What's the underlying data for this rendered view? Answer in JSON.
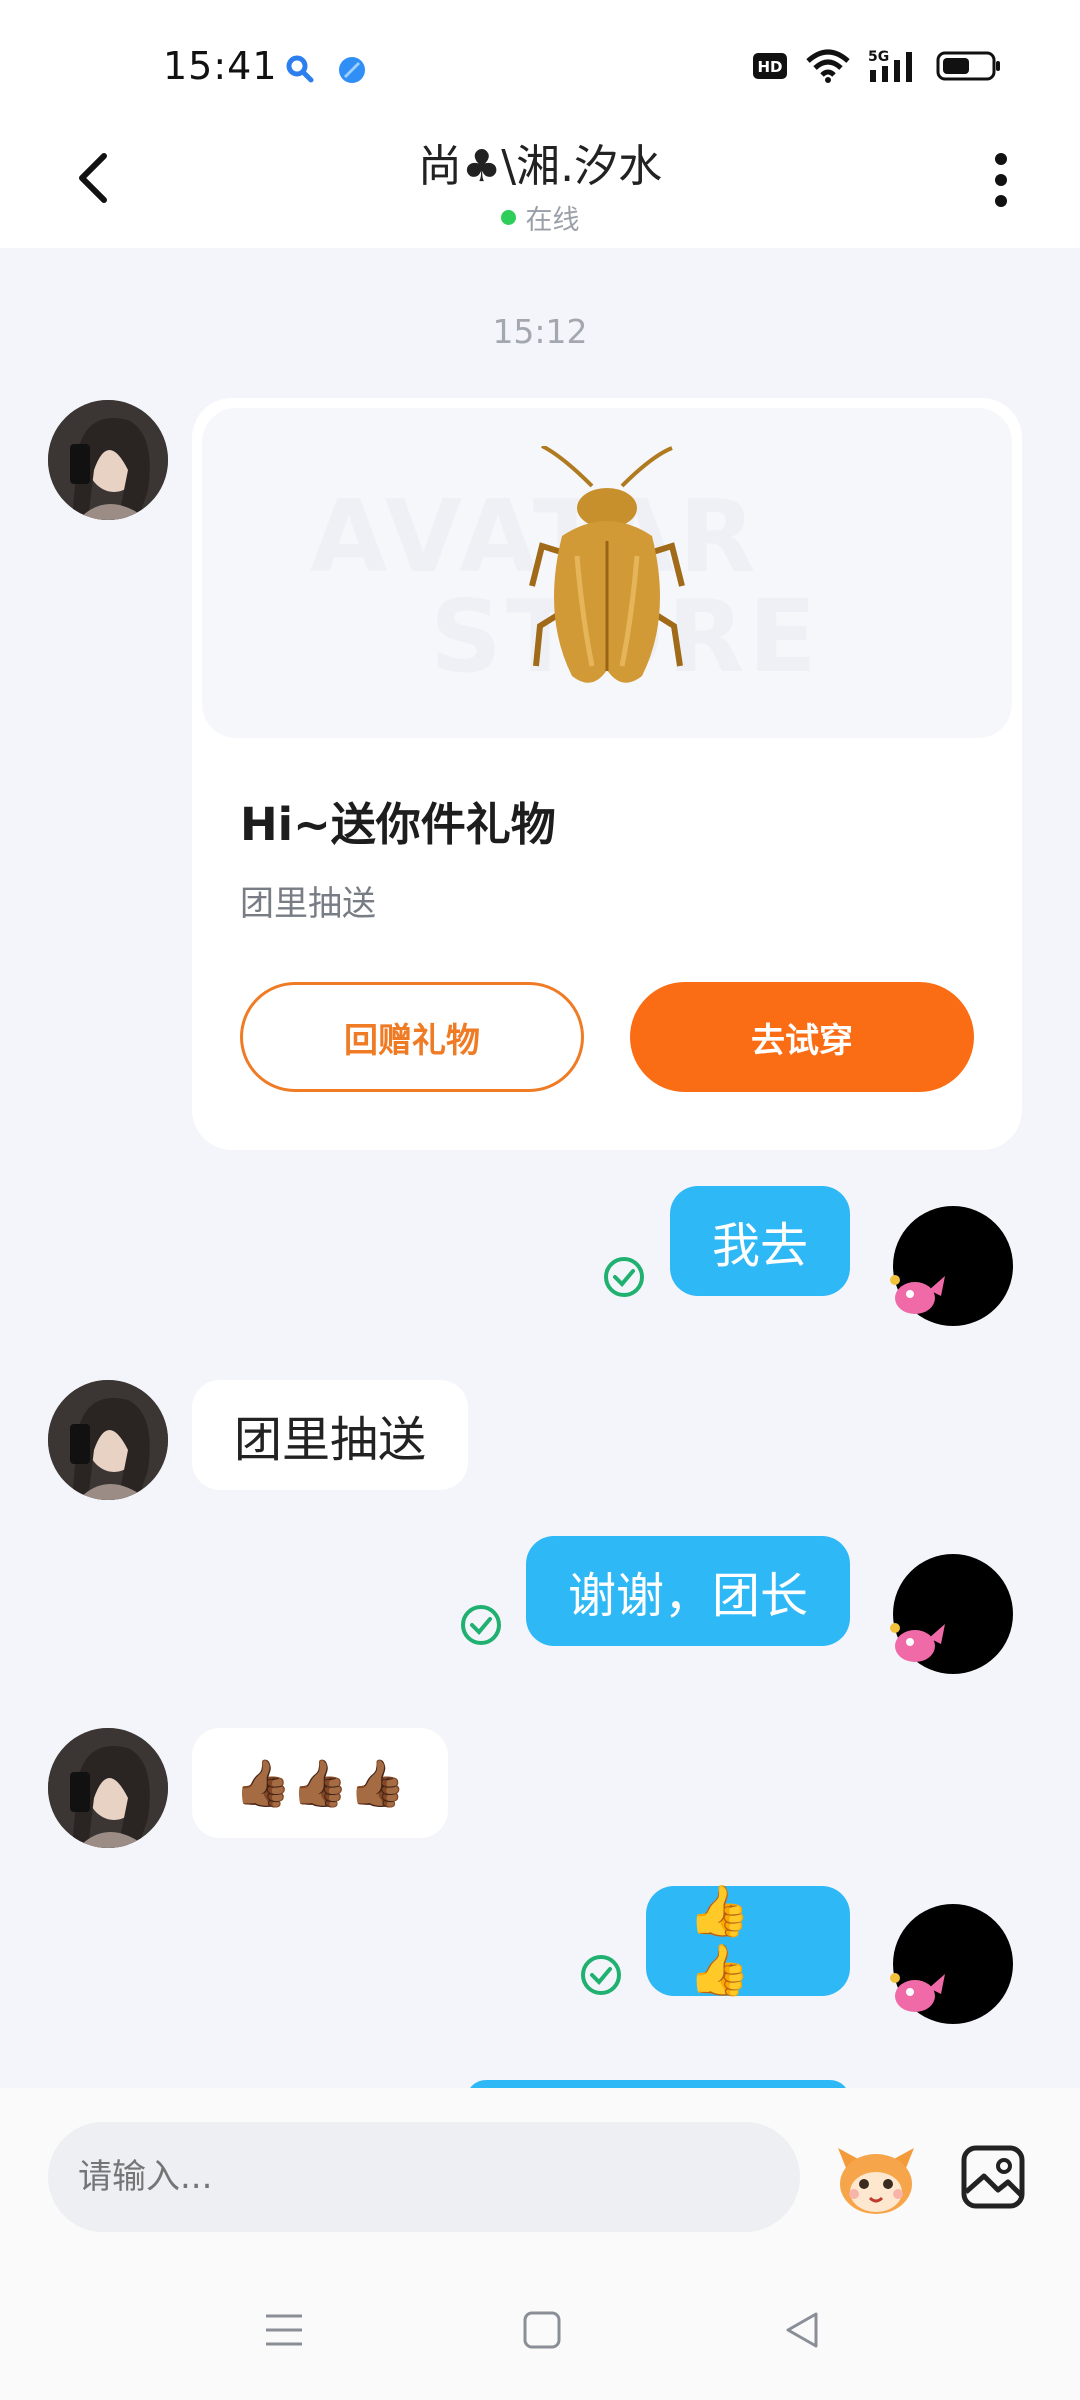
{
  "status_bar": {
    "time": "15:41",
    "icons": [
      "search-app-icon",
      "browser-app-icon",
      "hd-icon",
      "wifi-icon",
      "5g-signal-icon",
      "battery-icon"
    ],
    "hd_label": "HD",
    "network_label": "5G"
  },
  "header": {
    "title": "尚♣\\湘.汐水",
    "status": "在线",
    "status_color": "#2fce5a"
  },
  "chat": {
    "time_label": "15:12",
    "gift_card": {
      "title": "Hi~送你件礼物",
      "subtitle": "团里抽送",
      "watermark_1": "AVATAR",
      "watermark_2": "STORE",
      "button_return": "回赠礼物",
      "button_try": "去试穿",
      "accent_color": "#fb6d14"
    },
    "messages": [
      {
        "side": "right",
        "text": "我去"
      },
      {
        "side": "left",
        "text": "团里抽送"
      },
      {
        "side": "right",
        "text": "谢谢，团长"
      },
      {
        "side": "left",
        "text": "👍🏾👍🏾👍🏾"
      },
      {
        "side": "right",
        "text": "👍👍"
      }
    ],
    "bubble_color": "#2fb8f6"
  },
  "input_bar": {
    "placeholder": "请输入..."
  },
  "nav_bar": {
    "items": [
      "menu-icon",
      "home-icon",
      "back-triangle-icon"
    ]
  }
}
